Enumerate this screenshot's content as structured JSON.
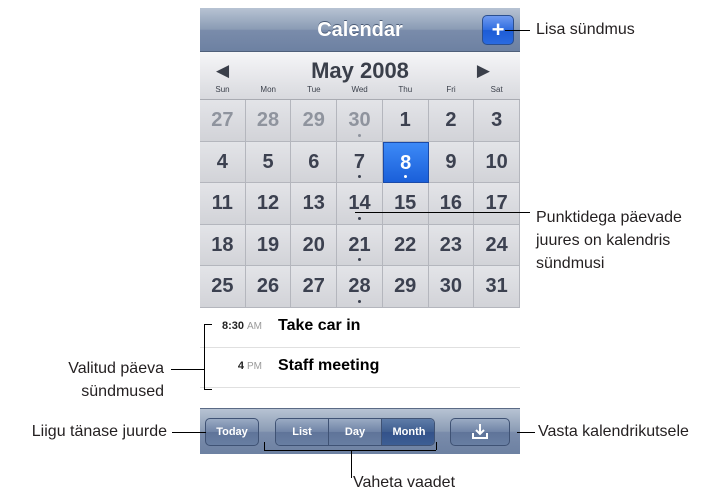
{
  "app": {
    "title": "Calendar",
    "add_label": "+"
  },
  "calendar": {
    "month_title": "May 2008",
    "prev_arrow": "◀",
    "next_arrow": "▶",
    "weekdays": [
      "Sun",
      "Mon",
      "Tue",
      "Wed",
      "Thu",
      "Fri",
      "Sat"
    ],
    "weeks": [
      [
        "27",
        "28",
        "29",
        "30",
        "1",
        "2",
        "3"
      ],
      [
        "4",
        "5",
        "6",
        "7",
        "8",
        "9",
        "10"
      ],
      [
        "11",
        "12",
        "13",
        "14",
        "15",
        "16",
        "17"
      ],
      [
        "18",
        "19",
        "20",
        "21",
        "22",
        "23",
        "24"
      ],
      [
        "25",
        "26",
        "27",
        "28",
        "29",
        "30",
        "31"
      ]
    ],
    "selected_day": "8",
    "days_with_events": [
      "30",
      "7",
      "8",
      "14",
      "21",
      "28"
    ]
  },
  "events": [
    {
      "time": "8:30",
      "ampm": "AM",
      "title": "Take car in"
    },
    {
      "time": "4",
      "ampm": "PM",
      "title": "Staff meeting"
    }
  ],
  "toolbar": {
    "today_label": "Today",
    "views": [
      "List",
      "Day",
      "Month"
    ],
    "active_view": "Month",
    "invite_icon": "download-tray-icon"
  },
  "annotations": {
    "add_event": "Lisa sündmus",
    "dots_line1": "Punktidega päevade",
    "dots_line2": "juures on kalendris",
    "dots_line3": "sündmusi",
    "selected_line1": "Valitud päeva",
    "selected_line2": "sündmused",
    "go_today": "Liigu tänase juurde",
    "respond_invite": "Vasta kalendrikutsele",
    "switch_view": "Vaheta vaadet"
  },
  "colors": {
    "selected_day": "#1a5fd9",
    "title_bar": "#7a8cab"
  }
}
